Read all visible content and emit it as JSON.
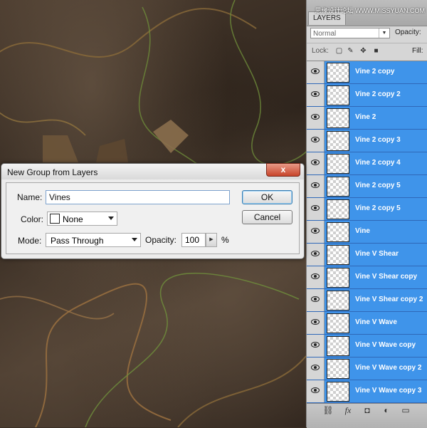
{
  "watermark": "思缘设计论坛 WWW.MISSYUAN.COM",
  "layers_panel": {
    "tab_label": "LAYERS",
    "blend_mode": "Normal",
    "opacity_label": "Opacity:",
    "lock_label": "Lock:",
    "fill_label": "Fill:",
    "layers": [
      {
        "name": "Vine 2 copy",
        "visible": true,
        "selected": true
      },
      {
        "name": "Vine 2 copy 2",
        "visible": true,
        "selected": true
      },
      {
        "name": "Vine 2",
        "visible": true,
        "selected": true
      },
      {
        "name": "Vine 2 copy 3",
        "visible": true,
        "selected": true
      },
      {
        "name": "Vine 2 copy 4",
        "visible": true,
        "selected": true
      },
      {
        "name": "Vine 2 copy 5",
        "visible": true,
        "selected": true
      },
      {
        "name": "Vine 2 copy 5",
        "visible": true,
        "selected": true
      },
      {
        "name": "Vine",
        "visible": true,
        "selected": true
      },
      {
        "name": "Vine V Shear",
        "visible": true,
        "selected": true
      },
      {
        "name": "Vine V Shear copy",
        "visible": true,
        "selected": true
      },
      {
        "name": "Vine V Shear copy 2",
        "visible": true,
        "selected": true
      },
      {
        "name": "Vine V Wave",
        "visible": true,
        "selected": true
      },
      {
        "name": "Vine V Wave copy",
        "visible": true,
        "selected": true
      },
      {
        "name": "Vine V Wave copy 2",
        "visible": true,
        "selected": true
      },
      {
        "name": "Vine V Wave copy 3",
        "visible": true,
        "selected": true
      }
    ],
    "footer_icons": [
      "link-icon",
      "fx-icon",
      "mask-icon",
      "adjustment-icon",
      "folder-icon"
    ],
    "selection_color": "#3f94ea"
  },
  "dialog": {
    "title": "New Group from Layers",
    "close_label": "x",
    "name_label": "Name:",
    "name_value": "Vines",
    "color_label": "Color:",
    "color_value": "None",
    "mode_label": "Mode:",
    "mode_value": "Pass Through",
    "opacity_label": "Opacity:",
    "opacity_value": "100",
    "opacity_unit": "%",
    "ok_label": "OK",
    "cancel_label": "Cancel"
  }
}
